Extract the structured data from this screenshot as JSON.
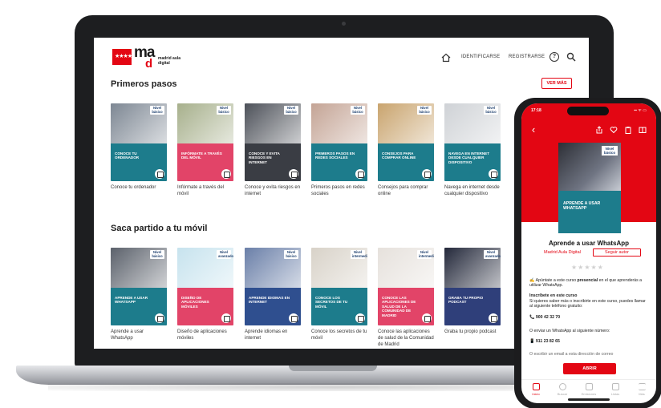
{
  "site": {
    "logo_flag": "★★★★",
    "logo_letters": "ma",
    "logo_letter_d": "d",
    "logo_subtitle": "madrid aula digital",
    "nav": {
      "identify": "IDENTIFICARSE",
      "register": "REGISTRARSE",
      "help": "?"
    }
  },
  "section1": {
    "title": "Primeros pasos",
    "see_more": "VER MÁS",
    "cards": [
      {
        "band": "CONOCE TU ORDENADOR",
        "caption": "Conoce tu ordenador",
        "badge": "Nivel básico",
        "color": "#1d7c8c",
        "photo": "#7d8793"
      },
      {
        "band": "INFÓRMATE A TRAVÉS DEL MÓVIL",
        "caption": "Infórmate a través del móvil",
        "badge": "Nivel básico",
        "color": "#e24468",
        "photo": "#a7b08c"
      },
      {
        "band": "CONOCE Y EVITA RIESGOS EN INTERNET",
        "caption": "Conoce y evita riesgos en internet",
        "badge": "Nivel básico",
        "color": "#3a3d44",
        "photo": "#4d5159"
      },
      {
        "band": "PRIMEROS PASOS EN REDES SOCIALES",
        "caption": "Primeros pasos en redes sociales",
        "badge": "Nivel básico",
        "color": "#1d7c8c",
        "photo": "#c4a495"
      },
      {
        "band": "CONSEJOS PARA COMPRAR ONLINE",
        "caption": "Consejos para comprar online",
        "badge": "Nivel básico",
        "color": "#1d7c8c",
        "photo": "#c9a46e"
      },
      {
        "band": "NAVEGA EN INTERNET DESDE CUALQUIER DISPOSITIVO",
        "caption": "Navega en internet desde cualquier dispositivo",
        "badge": "Nivel básico",
        "color": "#1d7c8c",
        "photo": "#cfd2d6"
      }
    ]
  },
  "section2": {
    "title": "Saca partido a tu móvil",
    "cards": [
      {
        "band": "APRENDE A USAR WHATSAPP",
        "caption": "Aprende a usar WhatsApp",
        "badge": "Nivel básico",
        "color": "#1d7c8c",
        "photo": "#5b616b"
      },
      {
        "band": "DISEÑO DE APLICACIONES MÓVILES",
        "caption": "Diseño de aplicaciones móviles",
        "badge": "Nivel avanzado",
        "color": "#e24468",
        "photo": "#c7e3ee"
      },
      {
        "band": "APRENDE IDIOMAS EN INTERNET",
        "caption": "Aprende idiomas en internet",
        "badge": "Nivel básico",
        "color": "#2f4f8f",
        "photo": "#6a7fa8"
      },
      {
        "band": "CONOCE LOS SECRETOS DE TU MÓVIL",
        "caption": "Conoce los secretos de tu móvil",
        "badge": "Nivel intermedio",
        "color": "#1d7c8c",
        "photo": "#d8d2c8"
      },
      {
        "band": "CONOCE LAS APLICACIONES DE SALUD DE LA COMUNIDAD DE MADRID",
        "caption": "Conoce las aplicaciones de salud de la Comunidad de Madrid",
        "badge": "Nivel intermedio",
        "color": "#e24468",
        "photo": "#e6e1dc"
      },
      {
        "band": "GRABA TU PROPIO PODCAST",
        "caption": "Graba tu propio podcast",
        "badge": "Nivel avanzado",
        "color": "#2f3f7a",
        "photo": "#23283a"
      }
    ]
  },
  "phone": {
    "time": "17:18",
    "status_right": "▪▪ ᯤ ▭",
    "back": "‹",
    "cover_band": "APRENDE A USAR WHATSAPP",
    "cover_badge": "Nivel básico",
    "title": "Aprende a usar WhatsApp",
    "author": "Madrid Aula Digital",
    "follow": "Seguir autor",
    "stars": "★★★★★",
    "line1_pre": "✍ Apúntate a este curso ",
    "line1_bold": "presencial",
    "line1_post": " en el que aprenderás a utilizar WhatsApp.",
    "enroll_title": "Inscríbete en este curso",
    "enroll_text": "Si quieres saber más o inscribirte en este curso, puedes llamar al siguiente teléfono gratuito:",
    "phone1": "📞 900 42 32 70",
    "whatsapp_text": "O enviar un WhatsApp al siguiente número:",
    "phone2": "📱 911 23 82 65",
    "email_text": "O escribir un email a esta dirección de correo",
    "open": "ABRIR",
    "tabs": [
      "Inicio",
      "Buscar",
      "Emisiones",
      "Listas",
      "Más"
    ]
  }
}
